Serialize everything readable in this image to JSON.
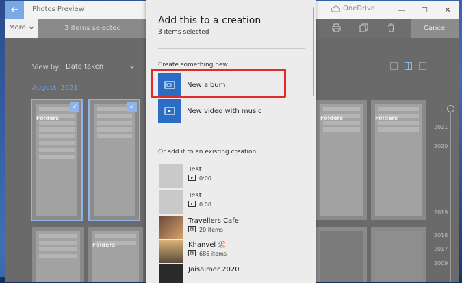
{
  "window": {
    "title": "Photos Preview",
    "onedrive_label": "OneDrive",
    "controls": [
      "—",
      "☐",
      "✕"
    ]
  },
  "toolbar": {
    "more_label": "More",
    "selected_count": "3 items selected",
    "cancel_label": "Cancel"
  },
  "view": {
    "viewby_label": "View by:",
    "viewby_value": "Date taken",
    "month": "August, 2021"
  },
  "thumbnails": {
    "folders_label": "Folders"
  },
  "timeline": {
    "years": [
      "2021",
      "2020",
      "2019",
      "2018",
      "2017",
      "2009"
    ]
  },
  "flyout": {
    "title": "Add this to a creation",
    "subtitle": "3 items selected",
    "create_section": "Create something new",
    "create_items": [
      {
        "label": "New album",
        "icon": "album-icon"
      },
      {
        "label": "New video with music",
        "icon": "video-icon"
      }
    ],
    "existing_section": "Or add it to an existing creation",
    "existing_items": [
      {
        "name": "Test",
        "meta": "0:00",
        "icon": "video-icon"
      },
      {
        "name": "Test",
        "meta": "0:00",
        "icon": "video-icon"
      },
      {
        "name": "Travellers Cafe",
        "meta": "20 items",
        "icon": "album-icon"
      },
      {
        "name": "Khanvel 🏖️",
        "meta": "686 items",
        "icon": "album-icon"
      },
      {
        "name": "Jaisalmer 2020",
        "meta": "",
        "icon": ""
      }
    ]
  },
  "colors": {
    "accent": "#2b6cc4",
    "highlight": "#e02a2a",
    "selection": "#8fb4ea"
  }
}
